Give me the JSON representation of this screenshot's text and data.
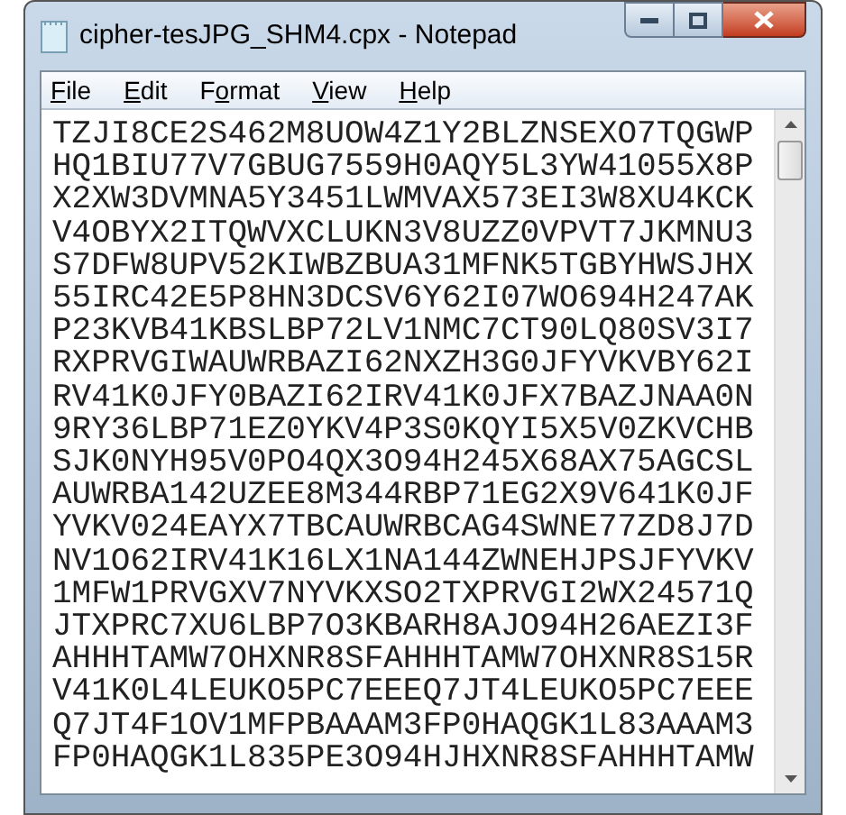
{
  "window": {
    "title": "cipher-tesJPG_SHM4.cpx - Notepad"
  },
  "menu": [
    {
      "access_key": "F",
      "label_after": "ile"
    },
    {
      "access_key": "E",
      "label_after": "dit"
    },
    {
      "label_before": "F",
      "access_key": "o",
      "label_after": "rmat"
    },
    {
      "access_key": "V",
      "label_after": "iew"
    },
    {
      "access_key": "H",
      "label_after": "elp"
    }
  ],
  "document": {
    "lines": [
      "TZJI8CE2S462M8UOW4Z1Y2BLZNSEXO7TQGWP",
      "HQ1BIU77V7GBUG7559H0AQY5L3YW41055X8P",
      "X2XW3DVMNA5Y3451LWMVAX573EI3W8XU4KCK",
      "V4OBYX2ITQWVXCLUKN3V8UZZ0VPVT7JKMNU3",
      "S7DFW8UPV52KIWBZBUA31MFNK5TGBYHWSJHX",
      "55IRC42E5P8HN3DCSV6Y62I07WO694H247AK",
      "P23KVB41KBSLBP72LV1NMC7CT90LQ80SV3I7",
      "RXPRVGIWAUWRBAZI62NXZH3G0JFYVKVBY62I",
      "RV41K0JFY0BAZI62IRV41K0JFX7BAZJNAA0N",
      "9RY36LBP71EZ0YKV4P3S0KQYI5X5V0ZKVCHB",
      "SJK0NYH95V0PO4QX3O94H245X68AX75AGCSL",
      "AUWRBA142UZEE8M344RBP71EG2X9V641K0JF",
      "YVKV024EAYX7TBCAUWRBCAG4SWNE77ZD8J7D",
      "NV1O62IRV41K16LX1NA144ZWNEHJPSJFYVKV",
      "1MFW1PRVGXV7NYVKXSO2TXPRVGI2WX24571Q",
      "JTXPRC7XU6LBP7O3KBARH8AJO94H26AEZI3F",
      "AHHHTAMW7OHXNR8SFAHHHTAMW7OHXNR8S15R",
      "V41K0L4LEUKO5PC7EEEQ7JT4LEUKO5PC7EEE",
      "Q7JT4F1OV1MFPBAAAM3FP0HAQGK1L83AAAM3",
      "FP0HAQGK1L835PE3O94HJHXNR8SFAHHHTAMW"
    ]
  }
}
